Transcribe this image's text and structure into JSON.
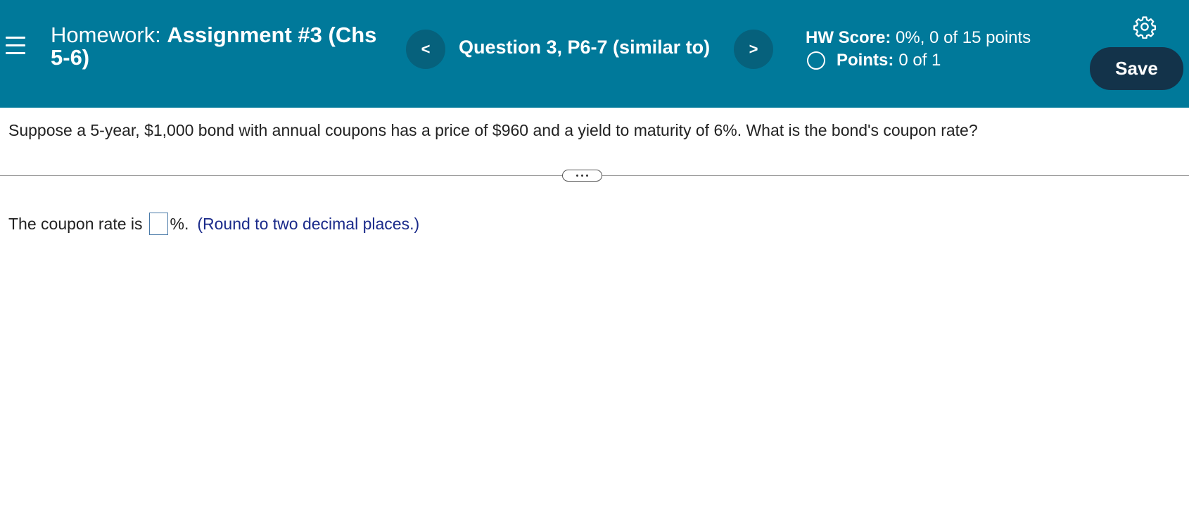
{
  "header": {
    "title_label": "Homework:",
    "title_name": "Assignment #3 (Chs 5-6)",
    "prev_icon": "<",
    "next_icon": ">",
    "question_label": "Question 3, P6-7 (similar to)",
    "hw_score_label": "HW Score:",
    "hw_score_value": "0%, 0 of 15 points",
    "points_label": "Points:",
    "points_value": "0 of 1",
    "save_label": "Save",
    "background_color": "#00799a",
    "save_color": "#13334a"
  },
  "question": {
    "text": "Suppose a 5-year, $1,000 bond with annual coupons has a price of $960 and a yield to maturity of 6%. What is the bond's coupon rate?"
  },
  "answer": {
    "prefix": "The coupon rate is",
    "input_value": "",
    "suffix": "%.",
    "hint": "(Round to two decimal places.)"
  },
  "icons": [
    "menu-icon",
    "chevron-left-icon",
    "chevron-right-icon",
    "gear-icon",
    "circle-icon",
    "more-dots-icon"
  ]
}
